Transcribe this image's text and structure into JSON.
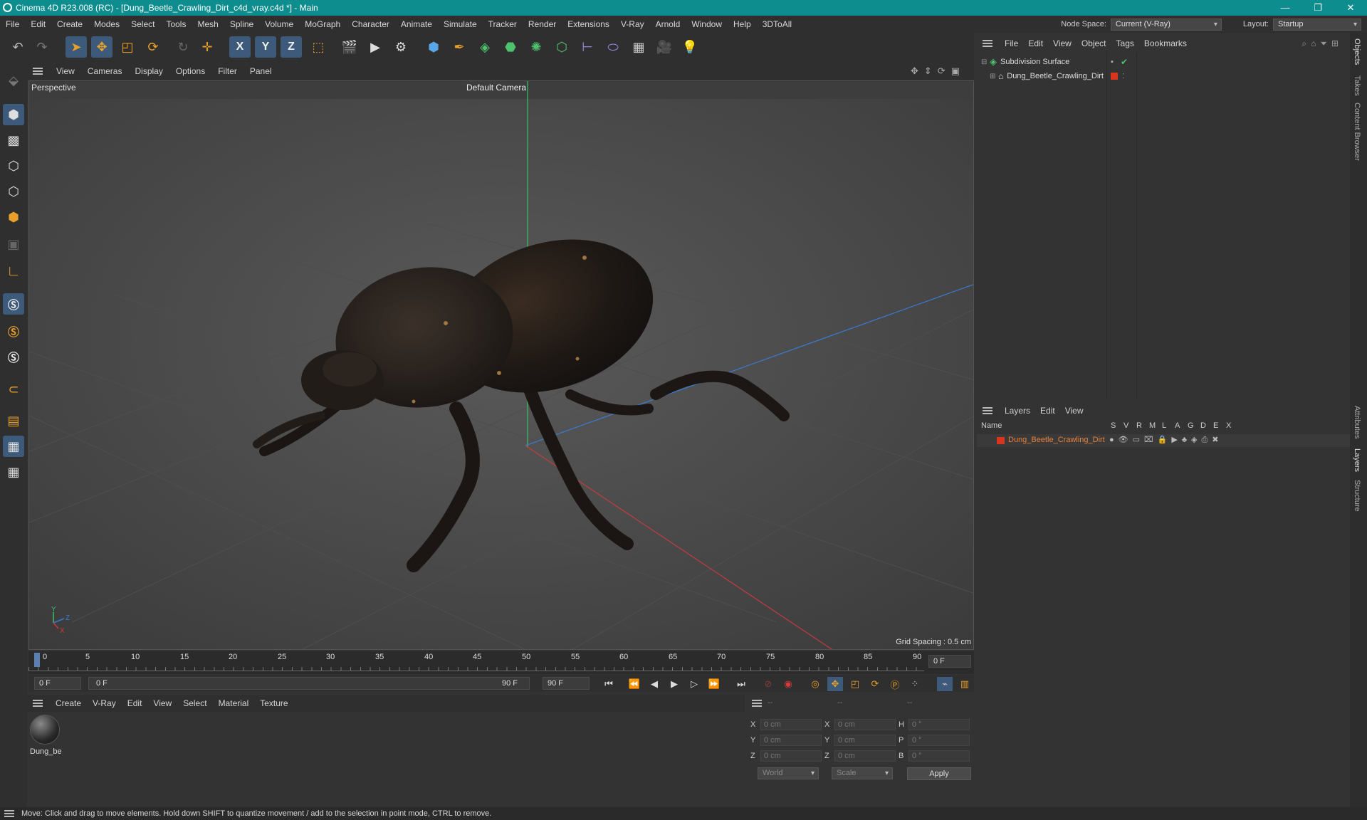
{
  "window": {
    "title": "Cinema 4D R23.008 (RC) - [Dung_Beetle_Crawling_Dirt_c4d_vray.c4d *] - Main",
    "controls": [
      "—",
      "❐",
      "✕"
    ]
  },
  "menubar": {
    "items": [
      "File",
      "Edit",
      "Create",
      "Modes",
      "Select",
      "Tools",
      "Mesh",
      "Spline",
      "Volume",
      "MoGraph",
      "Character",
      "Animate",
      "Simulate",
      "Tracker",
      "Render",
      "Extensions",
      "V-Ray",
      "Arnold",
      "Window",
      "Help",
      "3DToAll"
    ],
    "node_space_label": "Node Space:",
    "node_space_value": "Current (V-Ray)",
    "layout_label": "Layout:",
    "layout_value": "Startup"
  },
  "toolbar": {
    "axis_x": "X",
    "axis_y": "Y",
    "axis_z": "Z"
  },
  "viewport": {
    "menu": [
      "View",
      "Cameras",
      "Display",
      "Options",
      "Filter",
      "Panel"
    ],
    "label": "Perspective",
    "camera": "Default Camera",
    "grid_spacing": "Grid Spacing : 0.5 cm",
    "axes": {
      "x": "X",
      "y": "Y",
      "z": "Z"
    },
    "accent_colors": {
      "x_axis": "#c83a3a",
      "y_axis": "#3bbf6a",
      "z_axis": "#3a7ad0"
    }
  },
  "timeline": {
    "ticks": [
      "0",
      "5",
      "10",
      "15",
      "20",
      "25",
      "30",
      "35",
      "40",
      "45",
      "50",
      "55",
      "60",
      "65",
      "70",
      "75",
      "80",
      "85",
      "90"
    ],
    "current_frame": "0 F",
    "start_field": "0 F",
    "range_start": "0 F",
    "range_end": "90 F",
    "end_field": "90 F"
  },
  "material_manager": {
    "menu": [
      "Create",
      "V-Ray",
      "Edit",
      "View",
      "Select",
      "Material",
      "Texture"
    ],
    "materials": [
      {
        "name": "Dung_be"
      }
    ]
  },
  "coordinates": {
    "headers": [
      "--",
      "--",
      "--"
    ],
    "rows": [
      {
        "a": "X",
        "a_val": "0 cm",
        "b": "X",
        "b_val": "0 cm",
        "c": "H",
        "c_val": "0 °"
      },
      {
        "a": "Y",
        "a_val": "0 cm",
        "b": "Y",
        "b_val": "0 cm",
        "c": "P",
        "c_val": "0 °"
      },
      {
        "a": "Z",
        "a_val": "0 cm",
        "b": "Z",
        "b_val": "0 cm",
        "c": "B",
        "c_val": "0 °"
      }
    ],
    "space": "World",
    "mode": "Scale",
    "apply": "Apply"
  },
  "object_manager": {
    "menu": [
      "File",
      "Edit",
      "View",
      "Object",
      "Tags",
      "Bookmarks"
    ],
    "objects": [
      {
        "name": "Subdivision Surface"
      },
      {
        "name": "Dung_Beetle_Crawling_Dirt"
      }
    ]
  },
  "layer_manager": {
    "menu": [
      "Layers",
      "Edit",
      "View"
    ],
    "columns": [
      "Name",
      "S",
      "V",
      "R",
      "M",
      "L",
      "A",
      "G",
      "D",
      "E",
      "X"
    ],
    "layers": [
      {
        "name": "Dung_Beetle_Crawling_Dirt",
        "color": "#d8341e"
      }
    ]
  },
  "side_tabs": [
    "Objects",
    "Takes",
    "Content Browser",
    "Attributes",
    "Layers",
    "Structure"
  ],
  "status": "Move: Click and drag to move elements. Hold down SHIFT to quantize movement / add to the selection in point mode, CTRL to remove."
}
